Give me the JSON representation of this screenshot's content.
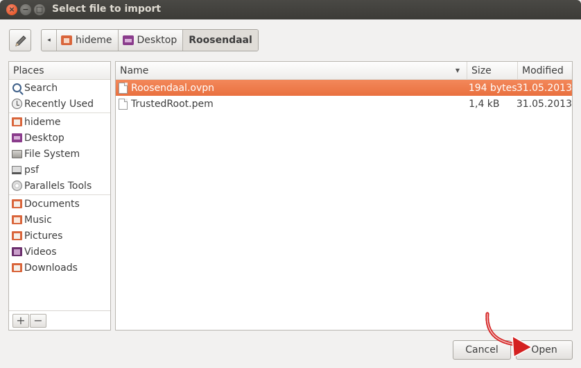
{
  "window": {
    "title": "Select file to import"
  },
  "breadcrumbs": [
    {
      "label": "hideme",
      "icon": "home-folder-icon"
    },
    {
      "label": "Desktop",
      "icon": "desktop-folder-icon"
    },
    {
      "label": "Roosendaal",
      "active": true
    }
  ],
  "places": {
    "header": "Places",
    "groups": [
      [
        {
          "label": "Search",
          "icon": "search-icon"
        },
        {
          "label": "Recently Used",
          "icon": "recent-icon"
        }
      ],
      [
        {
          "label": "hideme",
          "icon": "home-folder-icon"
        },
        {
          "label": "Desktop",
          "icon": "desktop-folder-icon"
        },
        {
          "label": "File System",
          "icon": "drive-icon"
        },
        {
          "label": "psf",
          "icon": "network-drive-icon"
        },
        {
          "label": "Parallels Tools",
          "icon": "cd-icon"
        }
      ],
      [
        {
          "label": "Documents",
          "icon": "documents-folder-icon"
        },
        {
          "label": "Music",
          "icon": "music-folder-icon"
        },
        {
          "label": "Pictures",
          "icon": "pictures-folder-icon"
        },
        {
          "label": "Videos",
          "icon": "videos-folder-icon"
        },
        {
          "label": "Downloads",
          "icon": "downloads-folder-icon"
        }
      ]
    ],
    "add_label": "+",
    "remove_label": "−"
  },
  "files": {
    "columns": {
      "name": "Name",
      "size": "Size",
      "modified": "Modified"
    },
    "rows": [
      {
        "name": "Roosendaal.ovpn",
        "size": "194 bytes",
        "modified": "31.05.2013",
        "selected": true
      },
      {
        "name": "TrustedRoot.pem",
        "size": "1,4 kB",
        "modified": "31.05.2013",
        "selected": false
      }
    ]
  },
  "buttons": {
    "cancel": "Cancel",
    "open": "Open"
  },
  "colors": {
    "selection": "#e9703f",
    "titlebar": "#3c3b37",
    "close": "#df4a16",
    "annotation": "#d42020"
  }
}
